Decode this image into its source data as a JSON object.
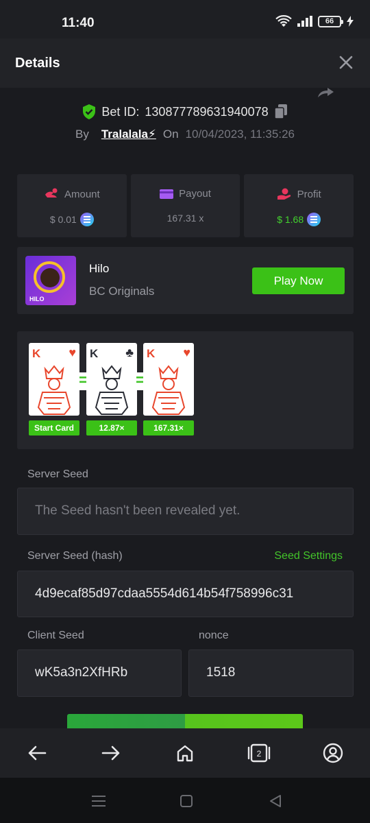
{
  "status": {
    "time": "11:40",
    "battery": "66"
  },
  "header": {
    "title": "Details"
  },
  "bet": {
    "id_label": "Bet ID:",
    "id": "130877789631940078",
    "by_label": "By",
    "user": "Tralalala⚡",
    "on_label": "On",
    "date": "10/04/2023, 11:35:26"
  },
  "stats": [
    {
      "label": "Amount",
      "value": "$ 0.01"
    },
    {
      "label": "Payout",
      "value": "167.31 x"
    },
    {
      "label": "Profit",
      "value": "$ 1.68"
    }
  ],
  "game": {
    "thumb_text": "HILO",
    "name": "Hilo",
    "provider": "BC Originals",
    "play_label": "Play Now"
  },
  "cards": [
    {
      "rank": "K",
      "suit": "♥",
      "color": "#e8462c",
      "tag": "Start Card"
    },
    {
      "rank": "K",
      "suit": "♣",
      "color": "#2b2d36",
      "tag": "12.87×"
    },
    {
      "rank": "K",
      "suit": "♥",
      "color": "#e8462c",
      "tag": "167.31×"
    }
  ],
  "equals": "=",
  "seeds": {
    "server_label": "Server Seed",
    "server_value": "The Seed hasn't been revealed yet.",
    "hash_label": "Server Seed (hash)",
    "settings_label": "Seed Settings",
    "hash_value": "4d9ecaf85d97cdaa5554d614b54f758996c31",
    "client_label": "Client Seed",
    "client_value": "wK5a3n2XfHRb",
    "nonce_label": "nonce",
    "nonce_value": "1518"
  },
  "bottom_nav": {
    "tabs_count": "2"
  },
  "colors": {
    "accent": "#3bc117",
    "background": "#1a1b1f",
    "panel": "#25262b"
  }
}
